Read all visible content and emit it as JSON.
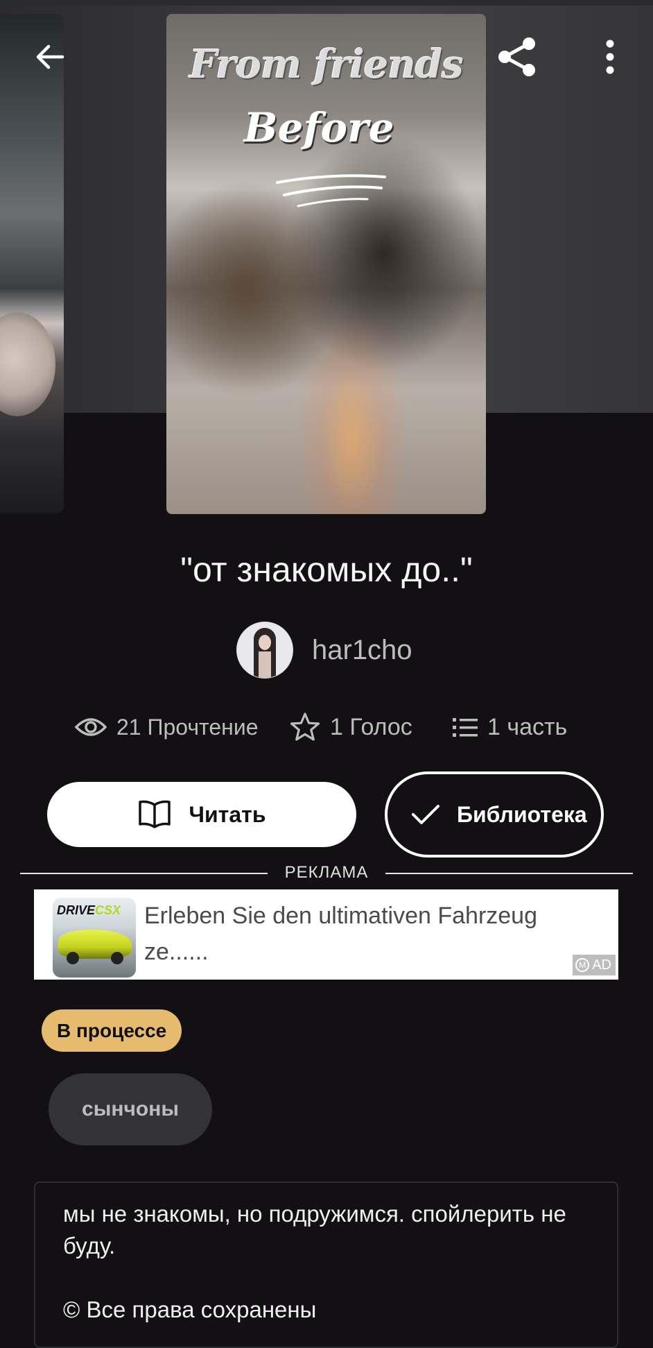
{
  "cover": {
    "title_line1": "From friends",
    "title_line2": "Before"
  },
  "story": {
    "title": "\"от знакомых до..\"",
    "author": "har1cho"
  },
  "stats": {
    "reads": "21 Прочтение",
    "votes": "1 Голос",
    "parts": "1 часть"
  },
  "actions": {
    "read_label": "Читать",
    "library_label": "Библиотека"
  },
  "ad": {
    "label": "РЕКЛАМА",
    "brand_prefix": "DRIVE",
    "brand_suffix": "CSX",
    "text": "Erleben Sie den ultimativen Fahrzeug ze......",
    "badge_m": "M",
    "badge": "AD"
  },
  "status": "В процессе",
  "tags": [
    "сынчоны"
  ],
  "description": {
    "text": "мы не знакомы, но подружимся. спойлерить не буду.",
    "copyright": "© Все права сохранены"
  },
  "colors": {
    "background": "#121013",
    "status_badge": "#e6bb6d",
    "tag_chip": "#333236"
  }
}
